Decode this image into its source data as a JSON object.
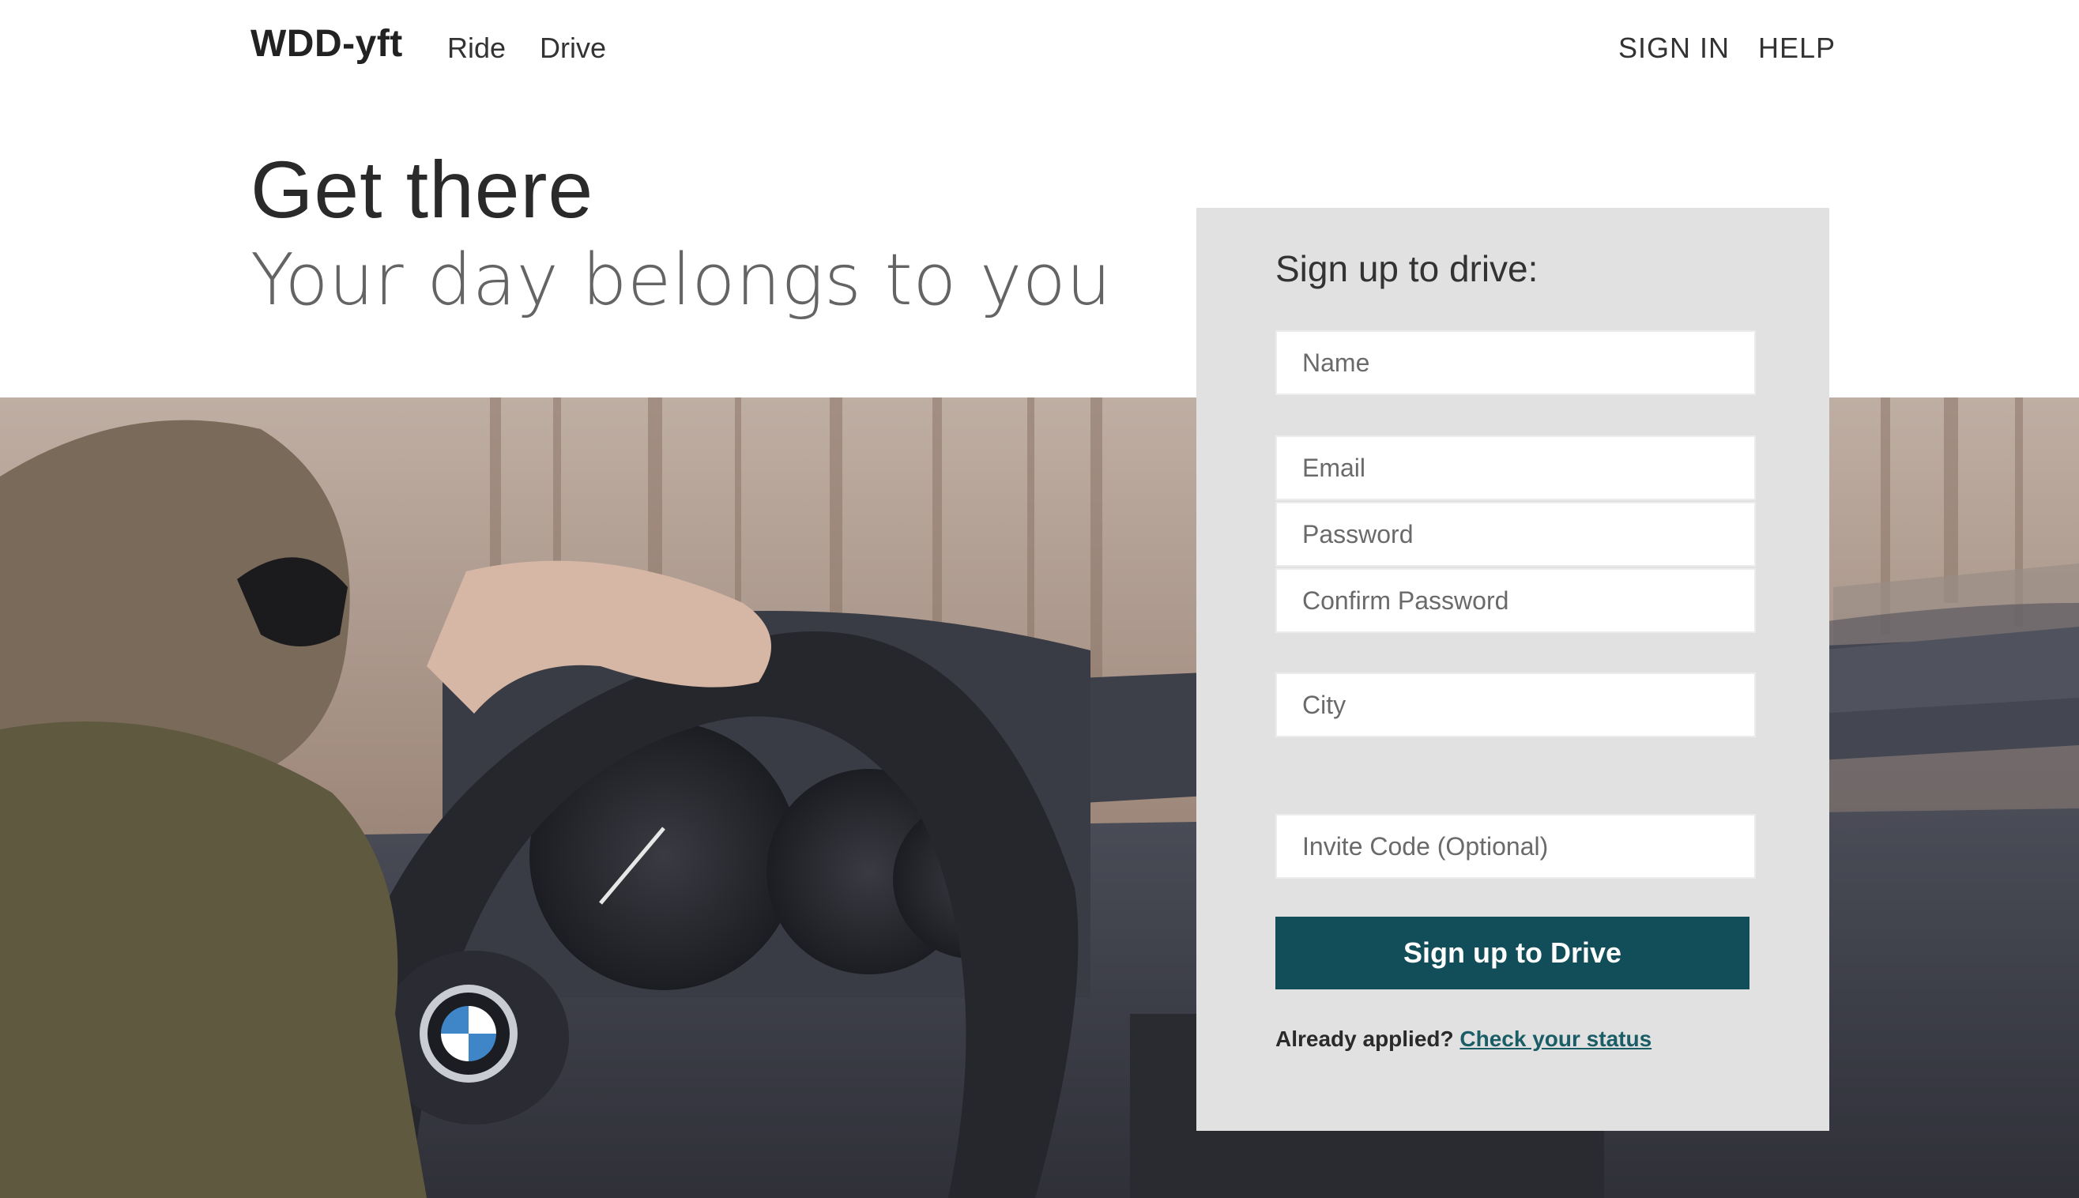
{
  "nav": {
    "brand": "WDD-yft",
    "links": [
      "Ride",
      "Drive"
    ],
    "sign_in": "SIGN IN",
    "help": "HELP"
  },
  "hero": {
    "title": "Get there",
    "subtitle": "Your day belongs to you"
  },
  "signup": {
    "title": "Sign up to drive:",
    "fields": {
      "name_placeholder": "Name",
      "email_placeholder": "Email",
      "password_placeholder": "Password",
      "confirm_placeholder": "Confirm Password",
      "city_placeholder": "City",
      "invite_placeholder": "Invite Code (Optional)"
    },
    "submit_label": "Sign up to Drive",
    "status_prompt": "Already applied?",
    "status_link": "Check your status"
  },
  "background": {
    "description_icon": "driver-in-car-photo",
    "steering_logo": "BMW"
  },
  "colors": {
    "button": "#124e59",
    "link": "#1a5d66",
    "panel": "#e1e1e1"
  }
}
